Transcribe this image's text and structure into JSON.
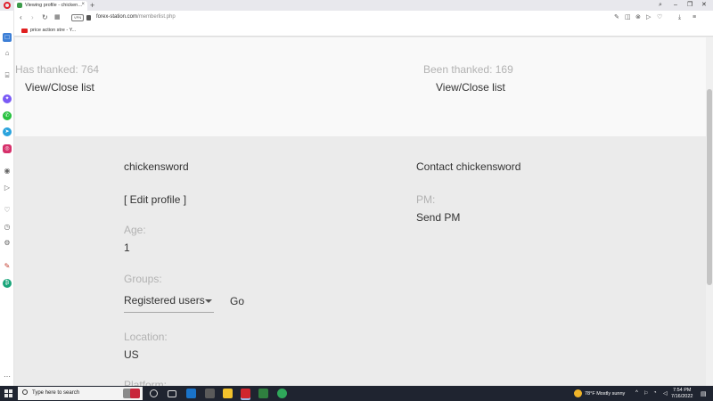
{
  "browser": {
    "tab_title": "Viewing profile - chicken…",
    "tab_close": "×",
    "new_tab": "+",
    "window_controls": [
      "–",
      "❐",
      "✕"
    ],
    "address": {
      "vpn_badge": "VPN",
      "url_domain": "forex-station.com",
      "url_path": "/memberlist.php"
    },
    "bookmark": {
      "label": "price action stre - Y..."
    },
    "toolbar_icons": [
      "edit-icon",
      "camera-icon",
      "close-circle-icon",
      "send-icon",
      "heart-icon",
      "download-icon",
      "menu-icon"
    ]
  },
  "sidebar": {
    "icons": [
      "workspace-icon",
      "home-icon",
      "shop-icon",
      "messenger-icon",
      "whatsapp-icon",
      "telegram-icon",
      "instagram-icon",
      "player-icon",
      "flow-icon",
      "heart-icon",
      "history-icon",
      "settings-icon",
      "pinboard-icon",
      "crypto-wallet-icon",
      "more-icon"
    ]
  },
  "profile": {
    "thanks": {
      "has_thanked_label": "Has thanked: 764",
      "been_thanked_label": "Been thanked: 169",
      "view_close_list": "View/Close list"
    },
    "username": "chickensword",
    "edit_profile": "[ Edit profile ]",
    "age_label": "Age:",
    "age_value": "1",
    "groups_label": "Groups:",
    "groups_selected": "Registered users",
    "go_button": "Go",
    "location_label": "Location:",
    "location_value": "US",
    "platform_label": "Platform:",
    "contact_title": "Contact chickensword",
    "pm_label": "PM:",
    "send_pm": "Send PM"
  },
  "taskbar": {
    "search_placeholder": "Type here to search",
    "weather": "78°F  Mostly sunny",
    "time": "7:54 PM",
    "date": "7/16/2022"
  },
  "colors": {
    "taskbar_bg": "#1f2430",
    "muted_text": "#b2b2b2",
    "body_text": "#333333",
    "lower_panel_bg": "#ebebeb",
    "upper_panel_bg": "#f9f9f9",
    "opera_red": "#e0212e"
  }
}
